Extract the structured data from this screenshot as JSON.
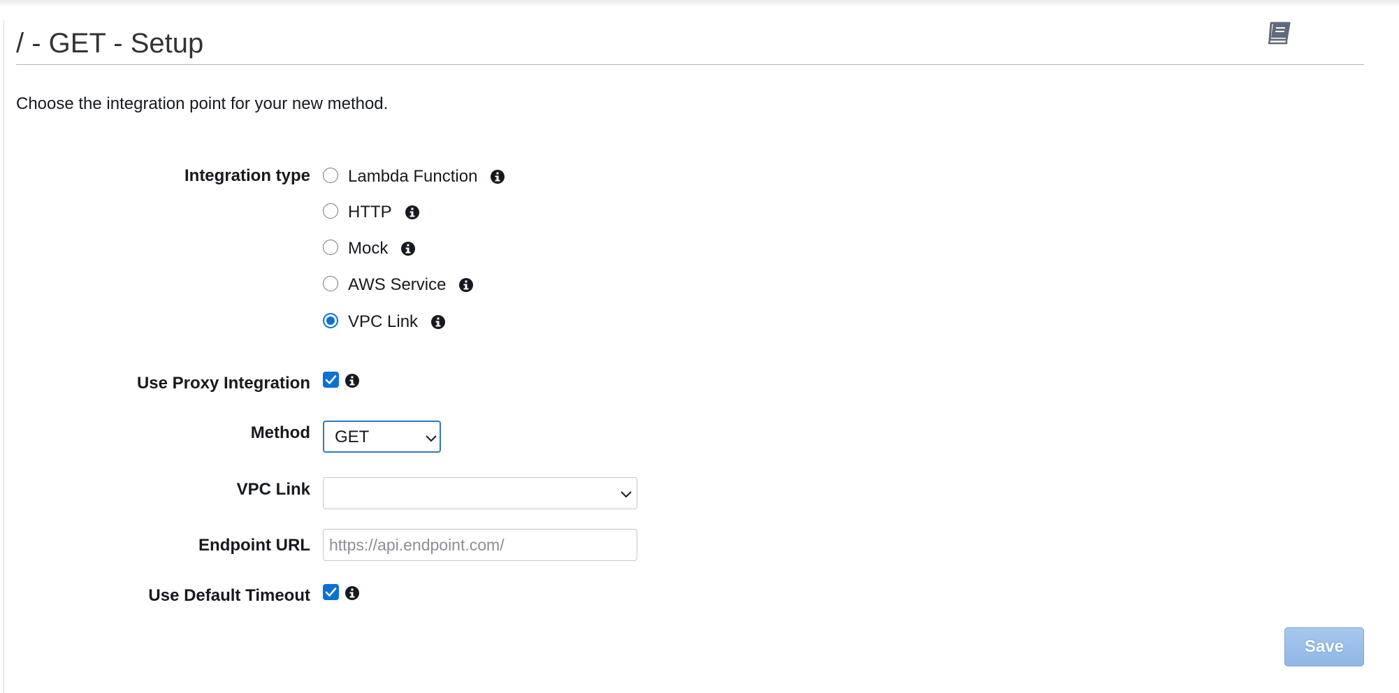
{
  "page": {
    "title": "/ - GET - Setup",
    "intro": "Choose the integration point for your new method."
  },
  "icons": {
    "docs": "book-icon",
    "info": "info-icon",
    "chevron": "chevron-down-icon",
    "checkmark": "checkmark-icon"
  },
  "colors": {
    "accent": "#0972d3",
    "save_button_bg": "#9ec1ea",
    "text": "#16191f",
    "placeholder": "#8a8f96"
  },
  "form": {
    "integration_type": {
      "label": "Integration type",
      "options": [
        {
          "label": "Lambda Function",
          "checked": false
        },
        {
          "label": "HTTP",
          "checked": false
        },
        {
          "label": "Mock",
          "checked": false
        },
        {
          "label": "AWS Service",
          "checked": false
        },
        {
          "label": "VPC Link",
          "checked": true
        }
      ]
    },
    "use_proxy": {
      "label": "Use Proxy Integration",
      "checked": true
    },
    "method": {
      "label": "Method",
      "value": "GET"
    },
    "vpc_link": {
      "label": "VPC Link",
      "value": ""
    },
    "endpoint_url": {
      "label": "Endpoint URL",
      "value": "",
      "placeholder": "https://api.endpoint.com/"
    },
    "default_timeout": {
      "label": "Use Default Timeout",
      "checked": true
    },
    "save_label": "Save"
  }
}
